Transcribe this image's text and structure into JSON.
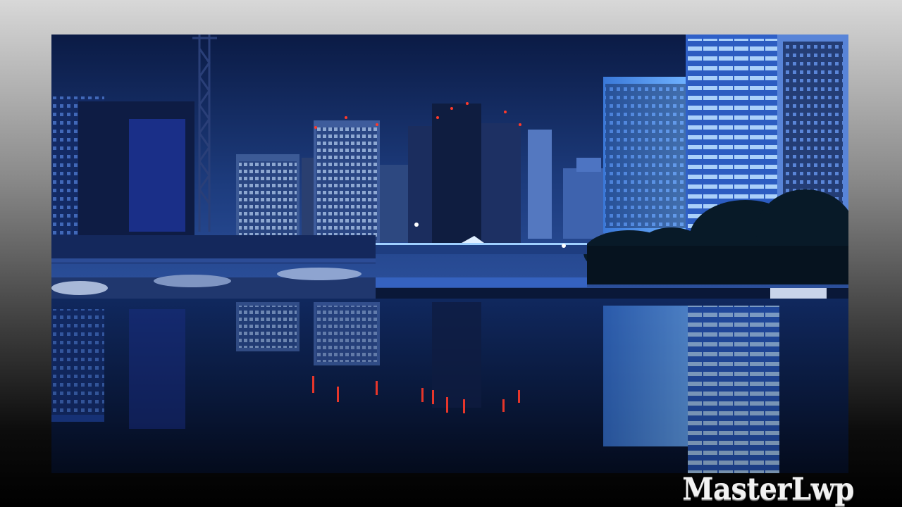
{
  "wallpaper": {
    "watermark_text": "MasterLwp"
  },
  "photo": {
    "scene": "night-city-waterfront",
    "colors": {
      "sky_top": "#0c1e4a",
      "sky_horizon": "#23448c",
      "building_glow": "#5aa8ff",
      "water": "#081632",
      "warning_lights": "#ff3a2a"
    }
  }
}
